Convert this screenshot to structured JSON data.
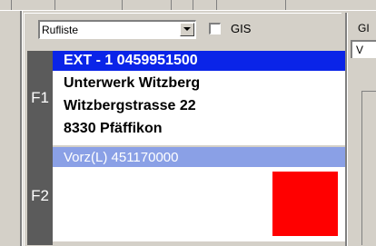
{
  "filter": {
    "dropdown_value": "Rufliste",
    "gis_label": "GIS",
    "gis_checked": false
  },
  "slots": {
    "f1": {
      "label": "F1",
      "lines": [
        "EXT - 1 0459951500",
        "Unterwerk Witzberg",
        "Witzbergstrasse 22",
        "8330 Pfäffikon"
      ]
    },
    "f2": {
      "label": "F2",
      "header": "Vorz(L) 451170000",
      "status_color": "#ff0000"
    }
  },
  "right_panel": {
    "tab_label": "GI",
    "field_value": "V"
  },
  "colors": {
    "highlight": "#0a24e8",
    "f2_header": "#8aa0e6",
    "f_strip": "#5b5b5b"
  }
}
